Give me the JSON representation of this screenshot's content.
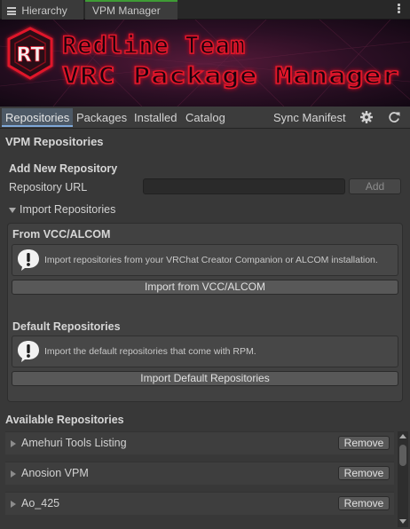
{
  "window_tabs": [
    {
      "label": "Hierarchy",
      "icon": "list-icon"
    },
    {
      "label": "VPM Manager",
      "icon": ""
    }
  ],
  "banner": {
    "line1": "Redline Team",
    "line2": "VRC Package Manager",
    "logo_letters": "RT",
    "accent": "#e0162b"
  },
  "toolbar": {
    "tabs": [
      "Repositories",
      "Packages",
      "Installed",
      "Catalog"
    ],
    "active_tab": "Repositories",
    "sync_label": "Sync Manifest",
    "settings_icon": "gear-icon",
    "refresh_icon": "refresh-icon"
  },
  "main": {
    "heading": "VPM Repositories",
    "add_section": {
      "title": "Add New Repository",
      "url_label": "Repository URL",
      "url_value": "",
      "add_label": "Add"
    },
    "import_foldout": "Import Repositories",
    "from_vcc": {
      "title": "From VCC/ALCOM",
      "help": "Import repositories from your VRChat Creator Companion or ALCOM installation.",
      "button": "Import from VCC/ALCOM"
    },
    "defaults": {
      "title": "Default Repositories",
      "help": "Import the default repositories that come with RPM.",
      "button": "Import Default Repositories"
    },
    "available_title": "Available Repositories",
    "repositories": [
      {
        "name": "Amehuri Tools Listing",
        "action": "Remove"
      },
      {
        "name": "Anosion VPM",
        "action": "Remove"
      },
      {
        "name": "Ao_425",
        "action": "Remove"
      }
    ]
  },
  "colors": {
    "active_tab": "#4d5966",
    "active_window_tab_accent": "#3f9c35",
    "panel": "#383838"
  }
}
